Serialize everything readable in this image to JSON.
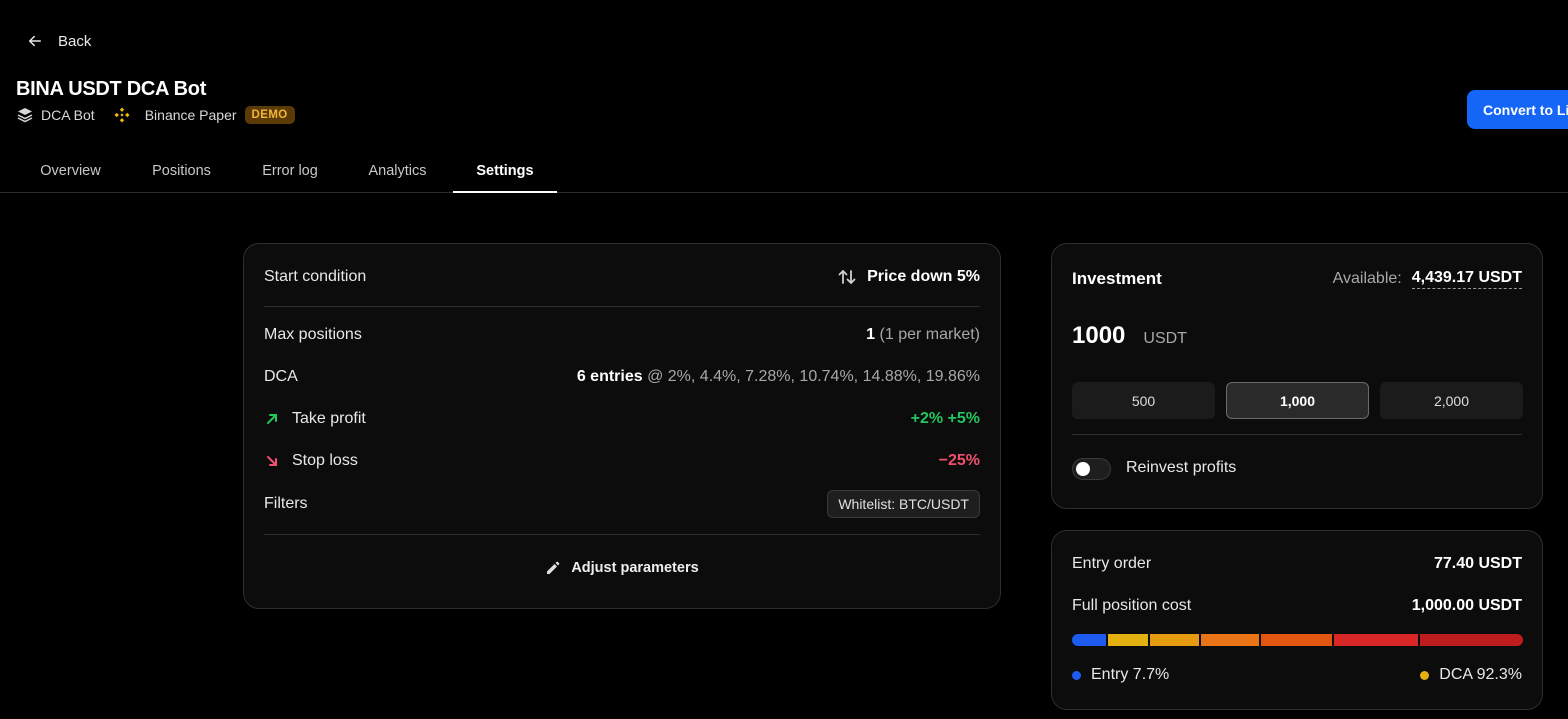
{
  "header": {
    "back_label": "Back",
    "title": "BINA USDT DCA Bot",
    "bot_type": "DCA Bot",
    "exchange": "Binance Paper",
    "badge": "DEMO",
    "convert_label": "Convert to Live"
  },
  "tabs": [
    {
      "label": "Overview"
    },
    {
      "label": "Positions"
    },
    {
      "label": "Error log"
    },
    {
      "label": "Analytics"
    },
    {
      "label": "Settings",
      "active": true
    }
  ],
  "settings": {
    "start_condition": {
      "label": "Start condition",
      "value": "Price down 5%"
    },
    "max_positions": {
      "label": "Max positions",
      "value": "1",
      "note": "(1 per market)"
    },
    "dca": {
      "label": "DCA",
      "entries": "6 entries",
      "detail": "@ 2%, 4.4%, 7.28%, 10.74%, 14.88%, 19.86%"
    },
    "take_profit": {
      "label": "Take profit",
      "value": "+2% +5%"
    },
    "stop_loss": {
      "label": "Stop loss",
      "value": "−25%"
    },
    "filters": {
      "label": "Filters",
      "chip": "Whitelist: BTC/USDT"
    },
    "adjust_label": "Adjust parameters"
  },
  "investment": {
    "title": "Investment",
    "available_label": "Available:",
    "available_value": "4,439.17 USDT",
    "amount": "1000",
    "currency": "USDT",
    "presets": [
      {
        "label": "500"
      },
      {
        "label": "1,000",
        "selected": true
      },
      {
        "label": "2,000"
      }
    ],
    "reinvest_label": "Reinvest profits",
    "reinvest_on": false
  },
  "cost": {
    "entry_order_label": "Entry order",
    "entry_order_value": "77.40 USDT",
    "full_cost_label": "Full position cost",
    "full_cost_value": "1,000.00 USDT",
    "segments": [
      {
        "share": 7.7,
        "color": "#1e5cf0"
      },
      {
        "share": 9.2,
        "color": "#e2b00f"
      },
      {
        "share": 11.1,
        "color": "#e59a10"
      },
      {
        "share": 13.3,
        "color": "#ea7517"
      },
      {
        "share": 16.0,
        "color": "#e2560f"
      },
      {
        "share": 19.2,
        "color": "#d92626"
      },
      {
        "share": 23.5,
        "color": "#bf1d1d"
      }
    ],
    "legend": [
      {
        "label": "Entry 7.7%",
        "color": "#1e5cf0"
      },
      {
        "label": "DCA 92.3%",
        "color": "#e2b00f"
      }
    ]
  }
}
